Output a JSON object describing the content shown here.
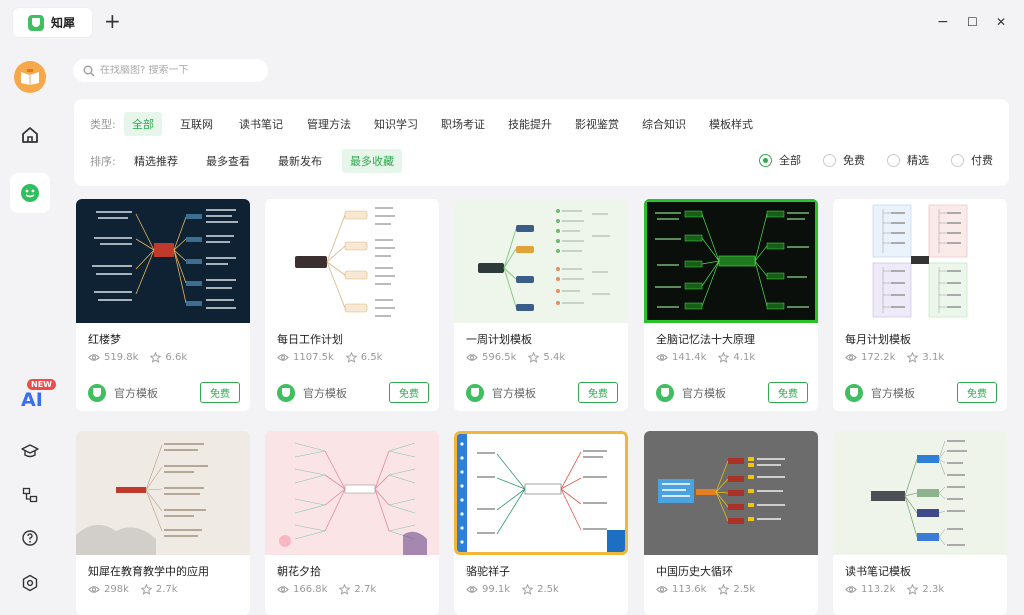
{
  "titlebar": {
    "tab_label": "知犀",
    "new_tab": "+",
    "minimize": "−",
    "maximize": "☐",
    "close": "✕"
  },
  "sidebar": {
    "ai_new_badge": "NEW",
    "ai_label": "AI"
  },
  "search": {
    "placeholder": "在找脑图? 搜索一下"
  },
  "filters": {
    "type_label": "类型:",
    "types": [
      "全部",
      "互联网",
      "读书笔记",
      "管理方法",
      "知识学习",
      "职场考证",
      "技能提升",
      "影视鉴赏",
      "综合知识",
      "模板样式"
    ],
    "type_selected": "全部",
    "sort_label": "排序:",
    "sorts": [
      "精选推荐",
      "最多查看",
      "最新发布",
      "最多收藏"
    ],
    "sort_selected": "最多收藏",
    "prices": [
      "全部",
      "免费",
      "精选",
      "付费"
    ],
    "price_selected": "全部"
  },
  "cards": [
    {
      "title": "红楼梦",
      "views": "519.8k",
      "stars": "6.6k",
      "author": "官方模板",
      "badge": "免费",
      "thumb": "dark-blue"
    },
    {
      "title": "每日工作计划",
      "views": "1107.5k",
      "stars": "6.5k",
      "author": "官方模板",
      "badge": "免费",
      "thumb": "white-tree"
    },
    {
      "title": "一周计划模板",
      "views": "596.5k",
      "stars": "5.4k",
      "author": "官方模板",
      "badge": "免费",
      "thumb": "green-mind"
    },
    {
      "title": "全脑记忆法十大原理",
      "views": "141.4k",
      "stars": "4.1k",
      "author": "官方模板",
      "badge": "免费",
      "thumb": "black-green"
    },
    {
      "title": "每月计划模板",
      "views": "172.2k",
      "stars": "3.1k",
      "author": "官方模板",
      "badge": "免费",
      "thumb": "pastel-grid"
    },
    {
      "title": "知犀在教育教学中的应用",
      "views": "298k",
      "stars": "2.7k",
      "author": "",
      "badge": "",
      "thumb": "ink"
    },
    {
      "title": "朝花夕拾",
      "views": "166.8k",
      "stars": "2.7k",
      "author": "",
      "badge": "",
      "thumb": "pink"
    },
    {
      "title": "骆驼祥子",
      "views": "99.1k",
      "stars": "2.5k",
      "author": "",
      "badge": "",
      "thumb": "notebook"
    },
    {
      "title": "中国历史大循环",
      "views": "113.6k",
      "stars": "2.5k",
      "author": "",
      "badge": "",
      "thumb": "gray"
    },
    {
      "title": "读书笔记模板",
      "views": "113.2k",
      "stars": "2.3k",
      "author": "",
      "badge": "",
      "thumb": "light-green"
    }
  ],
  "colors": {
    "accent": "#2fa84f",
    "brand": "#3fbf5f",
    "ai": "#3a6ef0",
    "new_badge": "#ef4b4b"
  }
}
